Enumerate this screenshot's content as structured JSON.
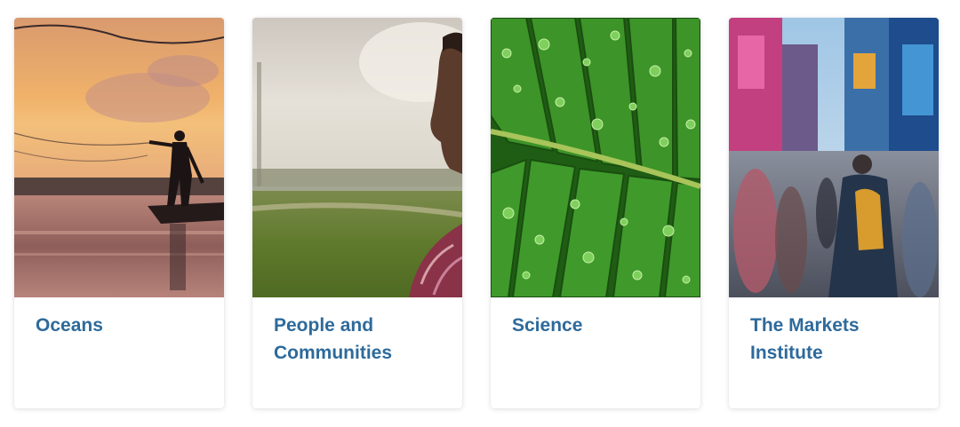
{
  "cards": [
    {
      "title": "Oceans"
    },
    {
      "title": "People and Communities"
    },
    {
      "title": "Science"
    },
    {
      "title": "The Markets Institute"
    }
  ],
  "colors": {
    "title_link": "#2e6a9b",
    "card_background": "#ffffff"
  },
  "icons": []
}
